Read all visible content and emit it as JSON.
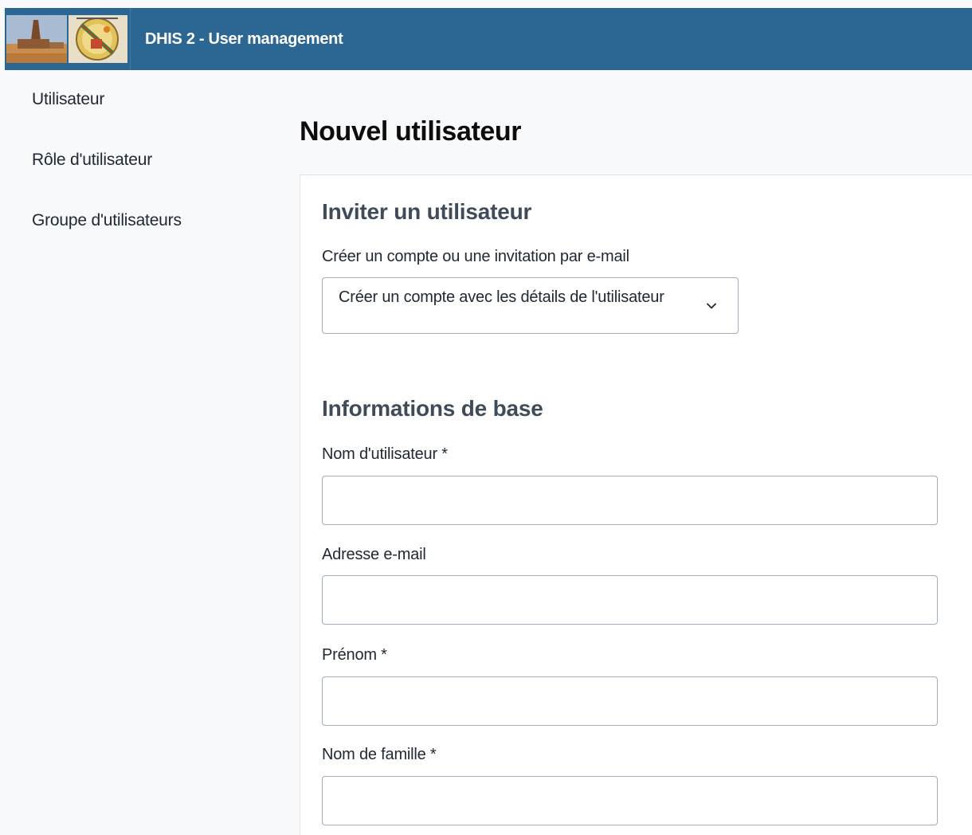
{
  "header": {
    "title": "DHIS 2 - User management",
    "logo_icon": "country-logo-icon",
    "color": "#2c6693"
  },
  "sidebar": {
    "items": [
      {
        "label": "Utilisateur"
      },
      {
        "label": "Rôle d'utilisateur"
      },
      {
        "label": "Groupe d'utilisateurs"
      }
    ]
  },
  "main": {
    "title": "Nouvel utilisateur",
    "invite_section": {
      "title": "Inviter un utilisateur",
      "select_label": "Créer un compte ou une invitation par e-mail",
      "select_value": "Créer un compte avec les détails de l'utilisateur",
      "select_icon": "chevron-down-icon"
    },
    "basic_section": {
      "title": "Informations de base",
      "fields": [
        {
          "label": "Nom d'utilisateur *",
          "value": ""
        },
        {
          "label": "Adresse e-mail",
          "value": ""
        },
        {
          "label": "Prénom *",
          "value": ""
        },
        {
          "label": "Nom de famille *",
          "value": ""
        }
      ]
    }
  }
}
